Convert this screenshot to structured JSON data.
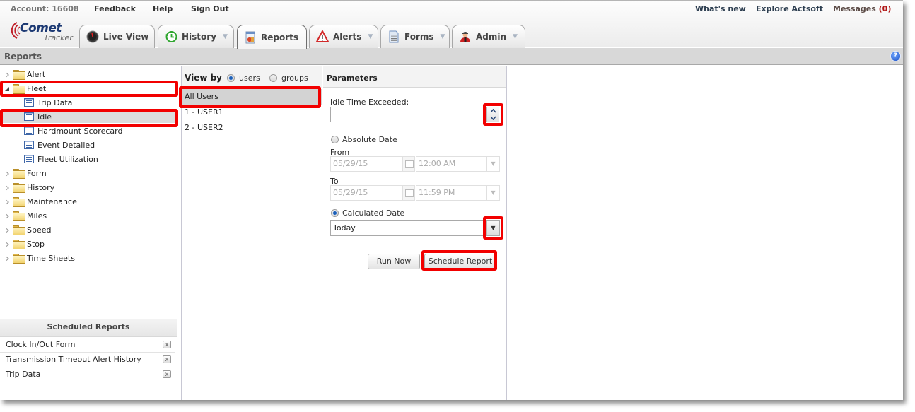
{
  "toplinks": {
    "account": "Account: 16608",
    "feedback": "Feedback",
    "help": "Help",
    "sign_out": "Sign Out",
    "whats_new": "What's new",
    "explore": "Explore Actsoft",
    "messages_label": "Messages",
    "messages_count": "(0)"
  },
  "logo": {
    "line1": "Comet",
    "line2": "Tracker"
  },
  "tabs": [
    {
      "label": "Live View",
      "icon": "speedometer-icon",
      "has_menu": false,
      "active": false
    },
    {
      "label": "History",
      "icon": "clock-icon",
      "has_menu": true,
      "active": false
    },
    {
      "label": "Reports",
      "icon": "report-icon",
      "has_menu": false,
      "active": true
    },
    {
      "label": "Alerts",
      "icon": "warning-icon",
      "has_menu": true,
      "active": false
    },
    {
      "label": "Forms",
      "icon": "document-icon",
      "has_menu": true,
      "active": false
    },
    {
      "label": "Admin",
      "icon": "user-icon",
      "has_menu": true,
      "active": false
    }
  ],
  "tab_menu_arrow": "▼",
  "section": {
    "title": "Reports",
    "help_glyph": "?"
  },
  "tree": [
    {
      "label": "Alert",
      "type": "folder",
      "expanded": false
    },
    {
      "label": "Fleet",
      "type": "folder",
      "expanded": true
    },
    {
      "label": "Trip Data",
      "type": "report"
    },
    {
      "label": "Idle",
      "type": "report",
      "selected": true
    },
    {
      "label": "Hardmount Scorecard",
      "type": "report"
    },
    {
      "label": "Event Detailed",
      "type": "report"
    },
    {
      "label": "Fleet Utilization",
      "type": "report"
    },
    {
      "label": "Form",
      "type": "folder",
      "expanded": false
    },
    {
      "label": "History",
      "type": "folder",
      "expanded": false
    },
    {
      "label": "Maintenance",
      "type": "folder",
      "expanded": false
    },
    {
      "label": "Miles",
      "type": "folder",
      "expanded": false
    },
    {
      "label": "Speed",
      "type": "folder",
      "expanded": false
    },
    {
      "label": "Stop",
      "type": "folder",
      "expanded": false
    },
    {
      "label": "Time Sheets",
      "type": "folder",
      "expanded": false
    }
  ],
  "scheduled": {
    "title": "Scheduled Reports",
    "remove_glyph": "x",
    "items": [
      "Clock In/Out Form",
      "Transmission Timeout Alert History",
      "Trip Data"
    ]
  },
  "view_by": {
    "label": "View by",
    "options": [
      "users",
      "groups"
    ],
    "selected": "users",
    "users": [
      "All Users",
      "1 - USER1",
      "2 - USER2"
    ],
    "selected_user": "All Users"
  },
  "params": {
    "title": "Parameters",
    "idle_label": "Idle Time Exceeded:",
    "idle_value": "",
    "absolute_label": "Absolute Date",
    "from_label": "From",
    "from_date": "05/29/15",
    "from_time": "12:00 AM",
    "to_label": "To",
    "to_date": "05/29/15",
    "to_time": "11:59 PM",
    "calculated_label": "Calculated Date",
    "calculated_value": "Today",
    "date_mode": "calculated",
    "run_now": "Run Now",
    "schedule": "Schedule Report"
  },
  "colors": {
    "highlight": "#f20000",
    "messages_count": "#b01818",
    "accent": "#1d3a74"
  }
}
